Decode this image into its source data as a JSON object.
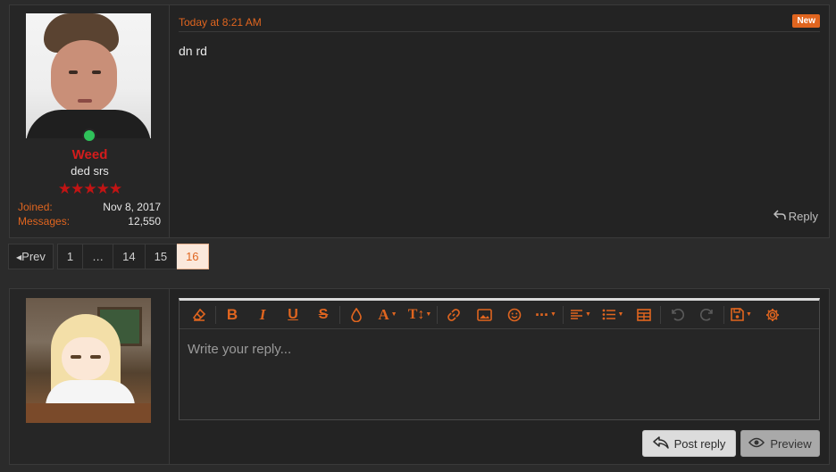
{
  "post": {
    "user": {
      "name": "Weed",
      "title": "ded srs",
      "stars": "★★★★★",
      "joined_label": "Joined:",
      "joined_value": "Nov 8, 2017",
      "messages_label": "Messages:",
      "messages_value": "12,550"
    },
    "timestamp": "Today at 8:21 AM",
    "badge": "New",
    "message": "dn rd",
    "reply_label": "Reply"
  },
  "pagination": {
    "prev_label": "Prev",
    "pages": [
      "1",
      "…",
      "14",
      "15",
      "16"
    ],
    "current": "16"
  },
  "reply_box": {
    "placeholder": "Write your reply...",
    "post_reply_label": "Post reply",
    "preview_label": "Preview"
  },
  "toolbar": {
    "icons": [
      "eraser-icon",
      "bold-icon",
      "italic-icon",
      "underline-icon",
      "strikethrough-icon",
      "text-color-icon",
      "font-family-icon",
      "font-size-icon",
      "link-icon",
      "image-icon",
      "smilie-icon",
      "more-icon",
      "align-icon",
      "list-icon",
      "table-icon",
      "undo-icon",
      "redo-icon",
      "drafts-icon",
      "settings-icon"
    ]
  },
  "colors": {
    "accent": "#e0651f",
    "username": "#d41c1c",
    "online": "#2fc25a",
    "background": "#2b2b2b",
    "panel": "#232323"
  }
}
